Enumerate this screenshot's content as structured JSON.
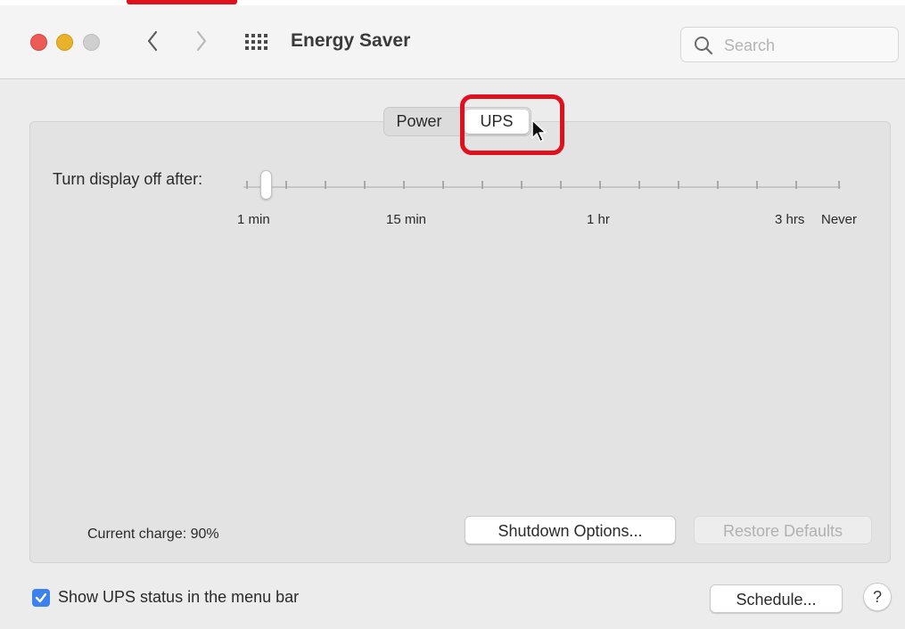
{
  "window": {
    "title": "Energy Saver",
    "search_placeholder": "Search"
  },
  "tabs": [
    {
      "label": "Power",
      "selected": false
    },
    {
      "label": "UPS",
      "selected": true
    }
  ],
  "slider": {
    "label": "Turn display off after:",
    "tick_labels": [
      "1 min",
      "15 min",
      "1 hr",
      "3 hrs",
      "Never"
    ],
    "value": "1 min"
  },
  "status": {
    "current_charge": "Current charge: 90%"
  },
  "buttons": {
    "shutdown": "Shutdown Options...",
    "restore": "Restore Defaults",
    "schedule": "Schedule...",
    "help": "?"
  },
  "checkbox": {
    "label": "Show UPS status in the menu bar",
    "checked": true
  },
  "colors": {
    "highlight": "#e0101c",
    "checkbox_accent": "#3b82f0"
  }
}
